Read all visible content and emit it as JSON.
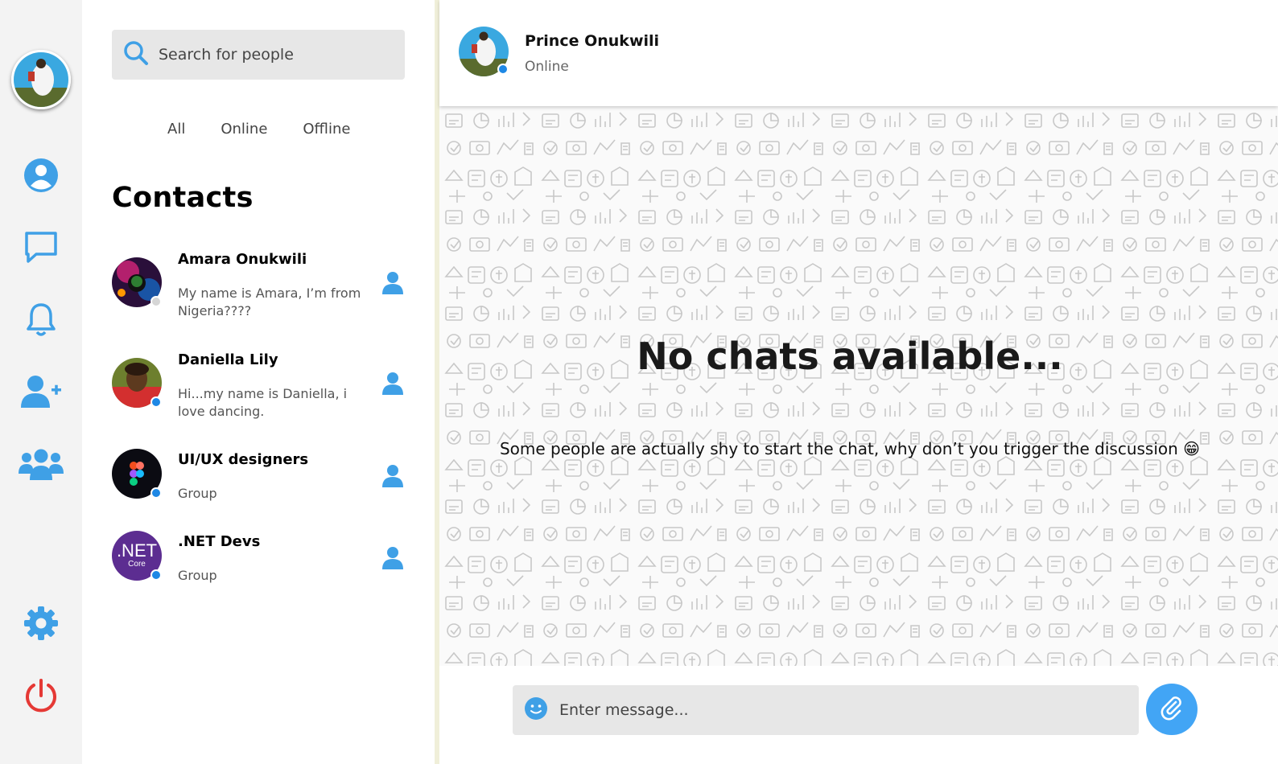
{
  "colors": {
    "accent": "#42a5f5",
    "icon_blue": "#3fa0e6",
    "power_red": "#e53935",
    "online": "#1e88e5",
    "offline": "#d6d6d6"
  },
  "rail": {
    "items": [
      {
        "name": "profile",
        "icon": "user-circle-icon"
      },
      {
        "name": "chats",
        "icon": "chat-bubble-icon"
      },
      {
        "name": "notifications",
        "icon": "bell-icon"
      },
      {
        "name": "add-contact",
        "icon": "user-plus-icon"
      },
      {
        "name": "groups",
        "icon": "group-icon"
      },
      {
        "name": "settings",
        "icon": "gear-icon"
      },
      {
        "name": "logout",
        "icon": "power-icon"
      }
    ]
  },
  "search": {
    "placeholder": "Search for people"
  },
  "filters": [
    "All",
    "Online",
    "Offline"
  ],
  "contacts_title": "Contacts",
  "contacts": [
    {
      "name": "Amara Onukwili",
      "subtitle": "My name is Amara, I’m from Nigeria????",
      "status": "offline"
    },
    {
      "name": "Daniella Lily",
      "subtitle": "Hi...my name is Daniella, i love dancing.",
      "status": "online"
    },
    {
      "name": "UI/UX designers",
      "subtitle": "Group",
      "status": "online",
      "avatar": "figma-logo"
    },
    {
      "name": ".NET Devs",
      "subtitle": "Group",
      "status": "online",
      "avatar": "dotnet-core-logo",
      "avatar_text": ".NET",
      "avatar_subtext": "Core"
    }
  ],
  "chat": {
    "name": "Prince Onukwili",
    "status": "Online",
    "empty_title": "No chats available...",
    "empty_subtitle": "Some people are actually shy to start the chat, why don’t you trigger the discussion 😁",
    "composer_placeholder": "Enter message..."
  }
}
